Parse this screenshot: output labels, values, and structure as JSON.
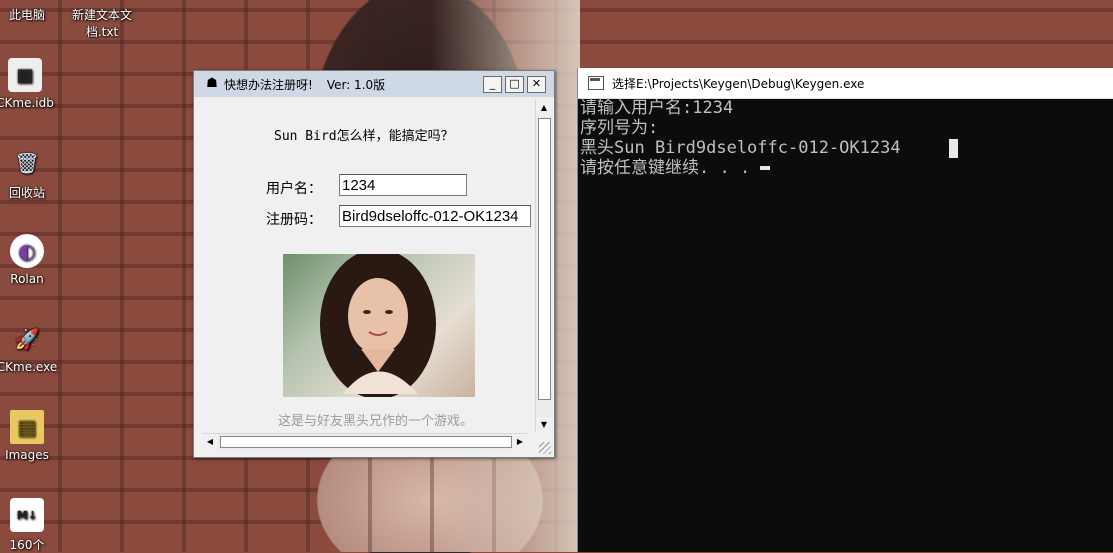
{
  "desktop": {
    "icons": [
      {
        "label": "此电脑",
        "icon": "computer-icon"
      },
      {
        "label": "新建文本文档.txt",
        "icon": "text-file-icon"
      },
      {
        "label": "CKme.idb",
        "icon": "idb-file-icon"
      },
      {
        "label": "回收站",
        "icon": "recycle-bin-icon"
      },
      {
        "label": "Rolan",
        "icon": "rolan-icon"
      },
      {
        "label": "CKme.exe",
        "icon": "rocket-app-icon"
      },
      {
        "label": "Images",
        "icon": "folder-icon"
      },
      {
        "label": "160个",
        "icon": "markdown-file-icon"
      }
    ]
  },
  "crackme": {
    "title": "快想办法注册呀!",
    "version": "Ver: 1.0版",
    "heading": "Sun Bird怎么样，能搞定吗？",
    "username_label": "用户名：",
    "username_value": "1234",
    "serial_label": "注册码：",
    "serial_value": "Bird9dseloffc-012-OK1234",
    "caption": "这是与好友黑头兄作的一个游戏。",
    "buttons": {
      "minimize": "_",
      "maximize": "□",
      "close": "✕"
    }
  },
  "console": {
    "title": "选择E:\\Projects\\Keygen\\Debug\\Keygen.exe",
    "lines": [
      "请输入用户名:1234",
      "序列号为:",
      "黑头Sun Bird9dseloffc-012-OK1234",
      "请按任意键继续. . ."
    ]
  }
}
